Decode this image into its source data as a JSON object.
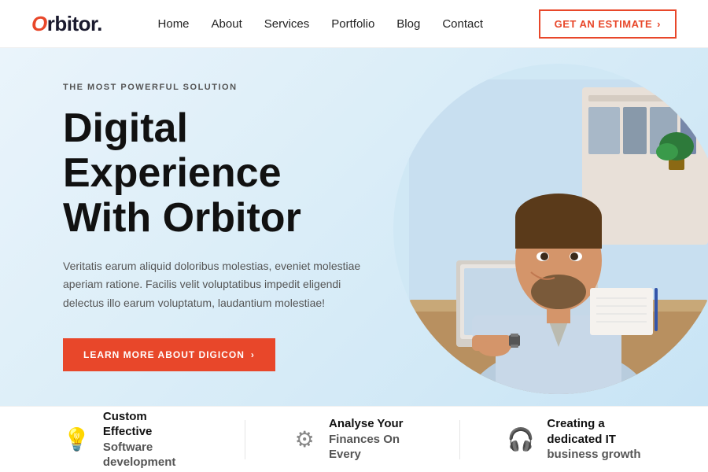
{
  "header": {
    "logo_prefix": "O",
    "logo_text": "rbitor.",
    "nav_items": [
      {
        "label": "Home",
        "href": "#"
      },
      {
        "label": "About",
        "href": "#"
      },
      {
        "label": "Services",
        "href": "#"
      },
      {
        "label": "Portfolio",
        "href": "#"
      },
      {
        "label": "Blog",
        "href": "#"
      },
      {
        "label": "Contact",
        "href": "#"
      }
    ],
    "cta_label": "GET AN ESTIMATE",
    "cta_arrow": "›"
  },
  "hero": {
    "eyebrow": "THE MOST POWERFUL SOLUTION",
    "title_line1": "Digital Experience",
    "title_line2": "With Orbitor",
    "description": "Veritatis earum aliquid doloribus molestias, eveniet molestiae aperiam ratione. Facilis velit voluptatibus impedit eligendi delectus illo earum voluptatum, laudantium molestiae!",
    "cta_label": "LEARN MORE ABOUT DIGICON",
    "cta_arrow": "›"
  },
  "features": [
    {
      "icon": "💡",
      "title_line1": "Custom Effective",
      "title_line2": "Software development"
    },
    {
      "icon": "⚙",
      "title_line1": "Analyse Your",
      "title_line2": "Finances On Every"
    },
    {
      "icon": "🎧",
      "title_line1": "Creating a dedicated IT",
      "title_line2": "business growth"
    }
  ]
}
